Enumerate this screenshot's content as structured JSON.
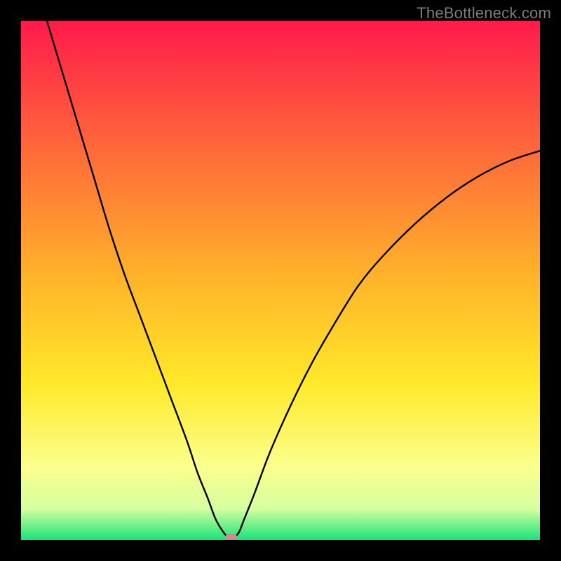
{
  "watermark": "TheBottleneck.com",
  "chart_data": {
    "type": "line",
    "title": "",
    "xlabel": "",
    "ylabel": "",
    "xlim": [
      0,
      100
    ],
    "ylim": [
      0,
      100
    ],
    "grid": false,
    "legend": false,
    "background_gradient": {
      "stops": [
        {
          "offset": 0.0,
          "color": "#ff1a4b"
        },
        {
          "offset": 0.25,
          "color": "#ff6a3a"
        },
        {
          "offset": 0.5,
          "color": "#ffb52a"
        },
        {
          "offset": 0.7,
          "color": "#ffe92a"
        },
        {
          "offset": 0.86,
          "color": "#fbff8e"
        },
        {
          "offset": 0.94,
          "color": "#d6ffa0"
        },
        {
          "offset": 1.0,
          "color": "#18e47a"
        }
      ]
    },
    "series": [
      {
        "name": "bottleneck-curve",
        "color": "#000000",
        "x": [
          5,
          8,
          11,
          14,
          17,
          20,
          23,
          26,
          29,
          32,
          34,
          36,
          37.5,
          39,
          40,
          41,
          42,
          43,
          45,
          48,
          52,
          56,
          60,
          65,
          70,
          76,
          82,
          88,
          94,
          100
        ],
        "y": [
          100,
          90,
          80,
          70,
          60,
          51,
          43,
          35,
          27,
          19,
          13,
          8,
          4,
          1.5,
          0.5,
          0.5,
          1.5,
          4,
          9,
          17,
          26,
          34,
          41,
          49,
          55,
          61,
          66,
          70,
          73,
          75
        ]
      }
    ],
    "marker": {
      "name": "marker-dot",
      "x": 40.5,
      "y": 0,
      "width": 2.2,
      "height": 1.2,
      "color": "#cf8b8b"
    }
  }
}
